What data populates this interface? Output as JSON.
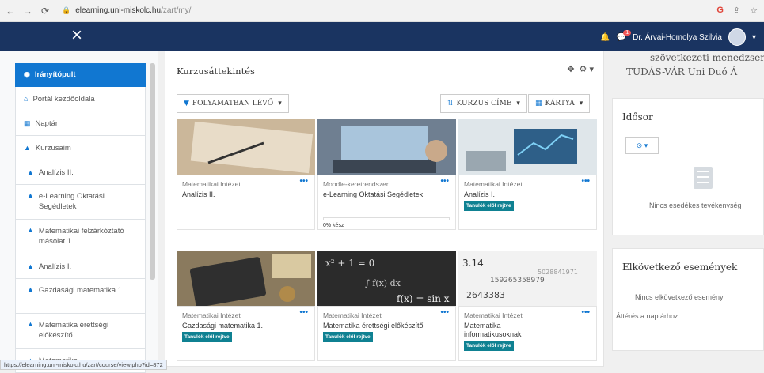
{
  "browser": {
    "url_host": "elearning.uni-miskolc.hu",
    "url_path": "/zart/my/"
  },
  "header": {
    "close_glyph": "×",
    "user_name": "Dr. Árvai-Homolya Szilvia",
    "notification_count": "1"
  },
  "sidebar": {
    "items": [
      {
        "label": "Irányítópult",
        "icon": "dashboard-icon"
      },
      {
        "label": "Portál kezdőoldala",
        "icon": "home-icon"
      },
      {
        "label": "Naptár",
        "icon": "calendar-icon"
      },
      {
        "label": "Kurzusaim",
        "icon": "graduation-cap-icon"
      },
      {
        "label": "Analízis II.",
        "icon": "graduation-cap-icon"
      },
      {
        "label": "e-Learning Oktatási Segédletek",
        "icon": "graduation-cap-icon"
      },
      {
        "label": "Matematikai felzárkóztató másolat 1",
        "icon": "graduation-cap-icon"
      },
      {
        "label": "Analízis I.",
        "icon": "graduation-cap-icon"
      },
      {
        "label": "Gazdasági matematika 1.",
        "icon": "graduation-cap-icon"
      },
      {
        "label": "Matematika érettségi előkészítő",
        "icon": "graduation-cap-icon"
      },
      {
        "label": "Matematika",
        "icon": "graduation-cap-icon"
      }
    ]
  },
  "overview": {
    "title": "Kurzusáttekintés",
    "filter_label": "FOLYAMATBAN LÉVŐ",
    "sort_label": "KURZUS CÍME",
    "view_label": "KÁRTYA"
  },
  "courses": [
    {
      "category": "Matematikai Intézet",
      "name": "Analízis II.",
      "tag": ""
    },
    {
      "category": "Moodle-keretrendszer",
      "name": "e-Learning Oktatási Segédletek",
      "tag": "",
      "progress_text": "0% kész",
      "progress": 0
    },
    {
      "category": "Matematikai Intézet",
      "name": "Analízis I.",
      "tag": "Tanulók elől rejtve"
    },
    {
      "category": "Matematikai Intézet",
      "name": "Gazdasági matematika 1.",
      "tag": "Tanulók elől rejtve"
    },
    {
      "category": "Matematikai Intézet",
      "name": "Matematika érettségi előkészítő",
      "tag": "Tanulók elől rejtve"
    },
    {
      "category": "Matematikai Intézet",
      "name": "Matematika informatikusoknak",
      "tag": "Tanulók elől rejtve"
    }
  ],
  "right": {
    "top_line1": "szövetkezeti menedzser",
    "top_line2": "TUDÁS-VÁR Uni Duó Á",
    "timeline_title": "Idősor",
    "timeline_empty": "Nincs esedékes tevékenység",
    "upcoming_title": "Elkövetkező események",
    "upcoming_empty": "Nincs elkövetkező esemény",
    "calendar_link": "Áttérés a naptárhoz..."
  },
  "status": {
    "url": "https://elearning.uni-miskolc.hu/zart/course/view.php?id=872"
  }
}
